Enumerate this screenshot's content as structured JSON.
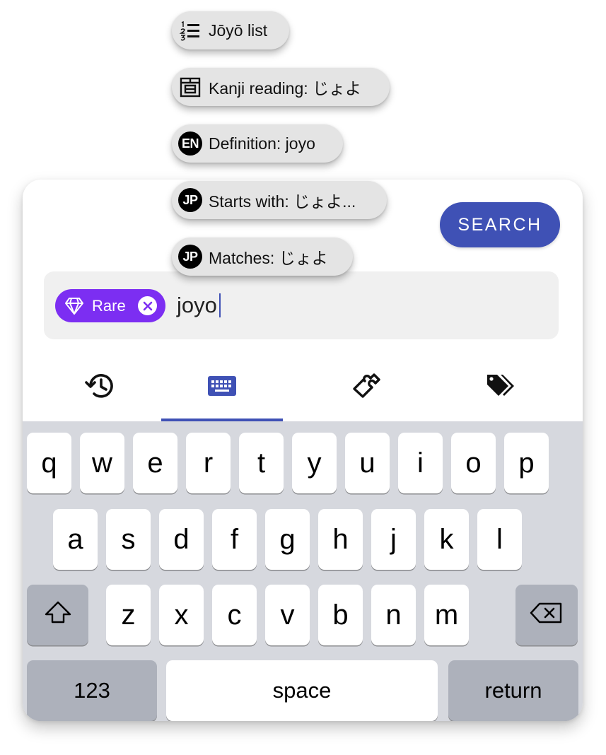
{
  "search_button": {
    "label": "SEARCH"
  },
  "input": {
    "chip_label": "Rare",
    "query": "joyo"
  },
  "suggestions": [
    {
      "icon": "list-numbered-icon",
      "badge": "",
      "text": "Jōyō list"
    },
    {
      "icon": "kanji-reading-icon",
      "badge": "",
      "text": "Kanji reading: じょよ"
    },
    {
      "icon": "en-badge-icon",
      "badge": "EN",
      "text": "Definition: joyo"
    },
    {
      "icon": "jp-badge-icon",
      "badge": "JP",
      "text": "Starts with: じょよ..."
    },
    {
      "icon": "jp-badge-icon",
      "badge": "JP",
      "text": "Matches: じょよ"
    }
  ],
  "tabs": [
    {
      "icon": "history-icon",
      "active": false
    },
    {
      "icon": "keyboard-icon",
      "active": true
    },
    {
      "icon": "puzzle-icon",
      "active": false
    },
    {
      "icon": "tags-icon",
      "active": false
    }
  ],
  "keyboard": {
    "row1": [
      "q",
      "w",
      "e",
      "r",
      "t",
      "y",
      "u",
      "i",
      "o",
      "p"
    ],
    "row2": [
      "a",
      "s",
      "d",
      "f",
      "g",
      "h",
      "j",
      "k",
      "l"
    ],
    "row3": [
      "z",
      "x",
      "c",
      "v",
      "b",
      "n",
      "m"
    ],
    "numbers_label": "123",
    "space_label": "space",
    "return_label": "return"
  },
  "colors": {
    "accent": "#3f51b5",
    "chip": "#7c2ef2",
    "keyboard_bg": "#d6d8de",
    "function_key": "#adb1bb"
  }
}
